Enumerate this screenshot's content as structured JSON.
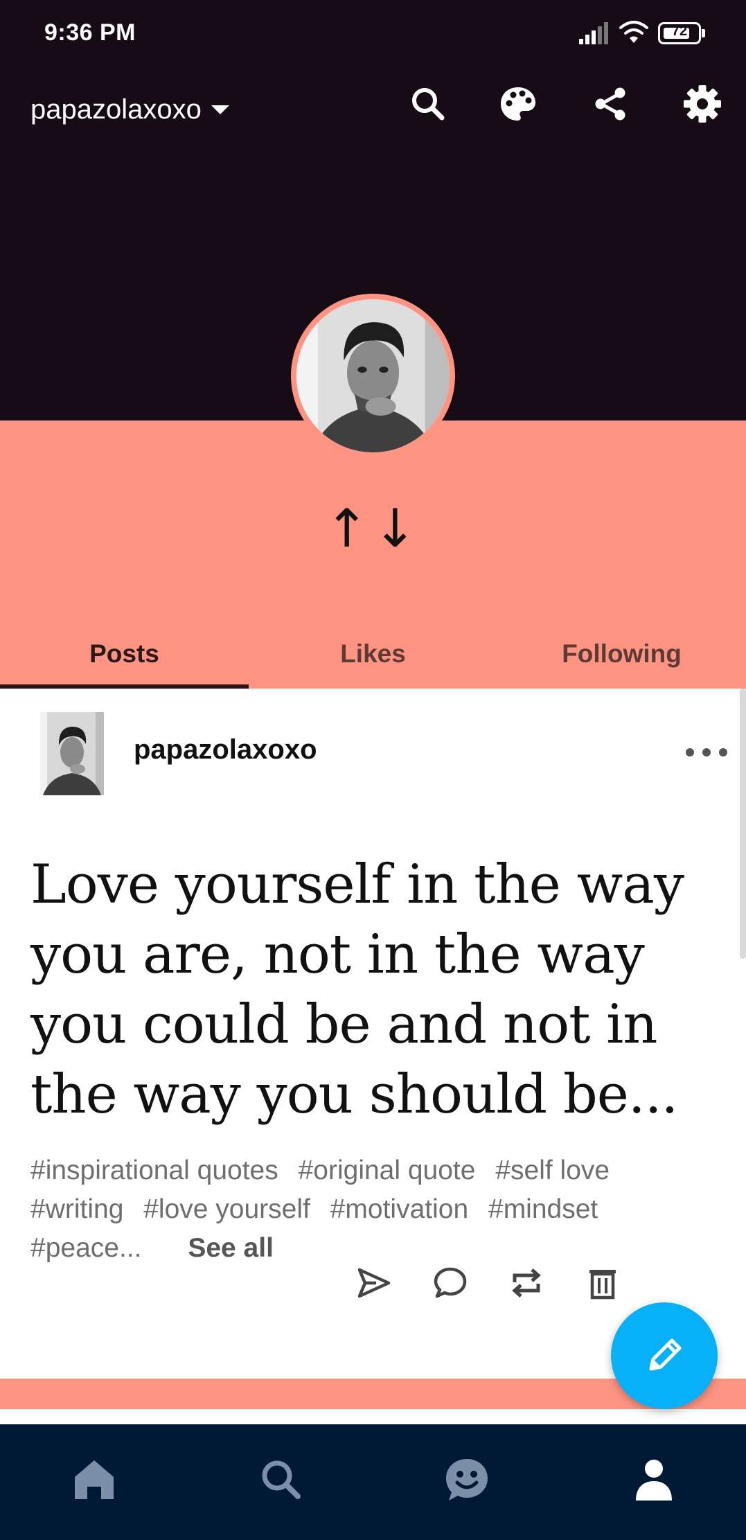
{
  "status_bar": {
    "time": "9:36 PM",
    "battery_level": "72",
    "icons": [
      "signal-icon",
      "wifi-icon",
      "battery-icon"
    ]
  },
  "header": {
    "blog_name": "papazolaxoxo",
    "icons": [
      "search-icon",
      "palette-icon",
      "share-icon",
      "settings-icon"
    ]
  },
  "profile": {
    "sort_arrows": "↑↓"
  },
  "tabs": [
    {
      "label": "Posts",
      "active": true
    },
    {
      "label": "Likes",
      "active": false
    },
    {
      "label": "Following",
      "active": false
    }
  ],
  "post": {
    "author": "papazolaxoxo",
    "quote": "Love yourself in the way you are, not in the way you could be and not in the way you should be...",
    "tags": [
      "#inspirational quotes",
      "#original quote",
      "#self love",
      "#writing",
      "#love yourself",
      "#motivation",
      "#mindset",
      "#peace..."
    ],
    "see_all": "See all",
    "actions": [
      "send-icon",
      "comment-icon",
      "reblog-icon",
      "delete-icon"
    ]
  },
  "fab": {
    "icon": "pencil-icon"
  },
  "bottom_nav": {
    "items": [
      "home-icon",
      "explore-icon",
      "activity-icon",
      "account-icon"
    ],
    "active": "account-icon"
  },
  "colors": {
    "header_bg": "#170c15",
    "accent_coral": "#ff9483",
    "fab_blue": "#08b0f8",
    "nav_bg": "#001935",
    "nav_icon": "#7c8fa8"
  }
}
